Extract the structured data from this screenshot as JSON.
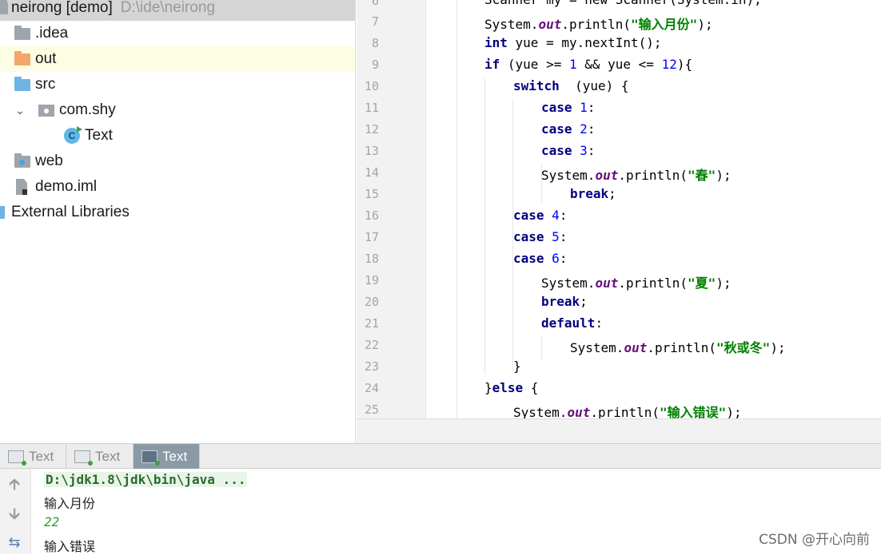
{
  "project": {
    "root_name": "neirong [demo]",
    "root_path": "D:\\ide\\neirong",
    "items": [
      {
        "label": ".idea",
        "icon": "folder-gray-icon"
      },
      {
        "label": "out",
        "icon": "folder-orange-icon"
      },
      {
        "label": "src",
        "icon": "folder-blue-icon"
      },
      {
        "label": "com.shy",
        "icon": "package-icon"
      },
      {
        "label": "Text",
        "icon": "java-class-icon"
      },
      {
        "label": "web",
        "icon": "web-folder-icon"
      },
      {
        "label": "demo.iml",
        "icon": "iml-file-icon"
      },
      {
        "label": "External Libraries",
        "icon": "libraries-icon"
      }
    ]
  },
  "editor": {
    "line_numbers": [
      "6",
      "7",
      "8",
      "9",
      "10",
      "11",
      "12",
      "13",
      "14",
      "15",
      "16",
      "17",
      "18",
      "19",
      "20",
      "21",
      "22",
      "23",
      "24",
      "25"
    ],
    "code": {
      "l6": "Scanner my = new Scanner(System.in);",
      "l7a": "System.",
      "l7b": "out",
      "l7c": ".println(",
      "l7d": "\"输入月份\"",
      "l7e": ");",
      "l8a": "int",
      "l8b": " yue = my.nextInt();",
      "l9a": "if",
      "l9b": " (yue >= ",
      "l9c": "1",
      "l9d": " && yue <= ",
      "l9e": "12",
      "l9f": "){",
      "l10a": "switch",
      "l10b": "  (yue) {",
      "l11a": "case",
      "l11b": "1",
      "l11c": ":",
      "l12a": "case",
      "l12b": "2",
      "l12c": ":",
      "l13a": "case",
      "l13b": "3",
      "l13c": ":",
      "l14a": "System.",
      "l14b": "out",
      "l14c": ".println(",
      "l14d": "\"春\"",
      "l14e": ");",
      "l15a": "break",
      "l15b": ";",
      "l16a": "case",
      "l16b": "4",
      "l16c": ":",
      "l17a": "case",
      "l17b": "5",
      "l17c": ":",
      "l18a": "case",
      "l18b": "6",
      "l18c": ":",
      "l19a": "System.",
      "l19b": "out",
      "l19c": ".println(",
      "l19d": "\"夏\"",
      "l19e": ");",
      "l20a": "break",
      "l20b": ";",
      "l21a": "default",
      "l21b": ":",
      "l22a": "System.",
      "l22b": "out",
      "l22c": ".println(",
      "l22d": "\"秋或冬\"",
      "l22e": ");",
      "l23": "}",
      "l24a": "}",
      "l24b": "else",
      "l24c": " {",
      "l25a": "System.",
      "l25b": "out",
      "l25c": ".println(",
      "l25d": "\"输入错误\"",
      "l25e": ");"
    }
  },
  "run_tabs": [
    {
      "label": "Text",
      "active": false
    },
    {
      "label": "Text",
      "active": false
    },
    {
      "label": "Text",
      "active": true
    }
  ],
  "console": {
    "command": "D:\\jdk1.8\\jdk\\bin\\java ...",
    "prompt": "输入月份",
    "user_input": "22",
    "result": "输入错误"
  },
  "watermark": "CSDN @开心向前",
  "colors": {
    "keyword": "#000080",
    "number": "#0000ff",
    "string": "#008000",
    "field": "#660e7a",
    "active_tab": "#8a9aa5"
  }
}
